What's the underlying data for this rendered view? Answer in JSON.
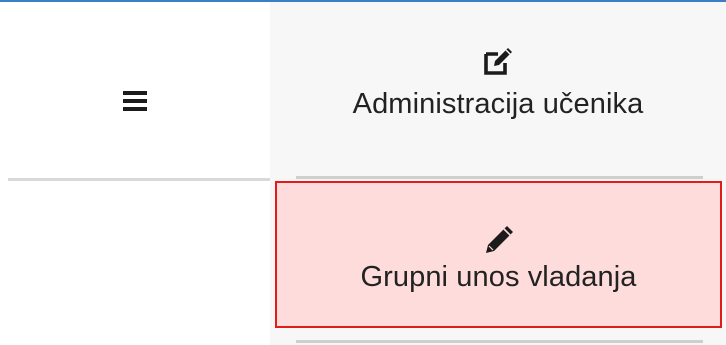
{
  "header": {
    "menu_toggle_icon": "hamburger-menu-icon"
  },
  "menu": {
    "items": [
      {
        "icon": "edit-icon",
        "label": "Administracija učenika"
      },
      {
        "icon": "pencil-icon",
        "label": "Grupni unos vladanja",
        "highlighted": true
      }
    ]
  },
  "colors": {
    "accent_top_line": "#3a7fc3",
    "highlight_background": "#ffdcdc",
    "highlight_border": "#e21b1b",
    "text": "#222222"
  }
}
